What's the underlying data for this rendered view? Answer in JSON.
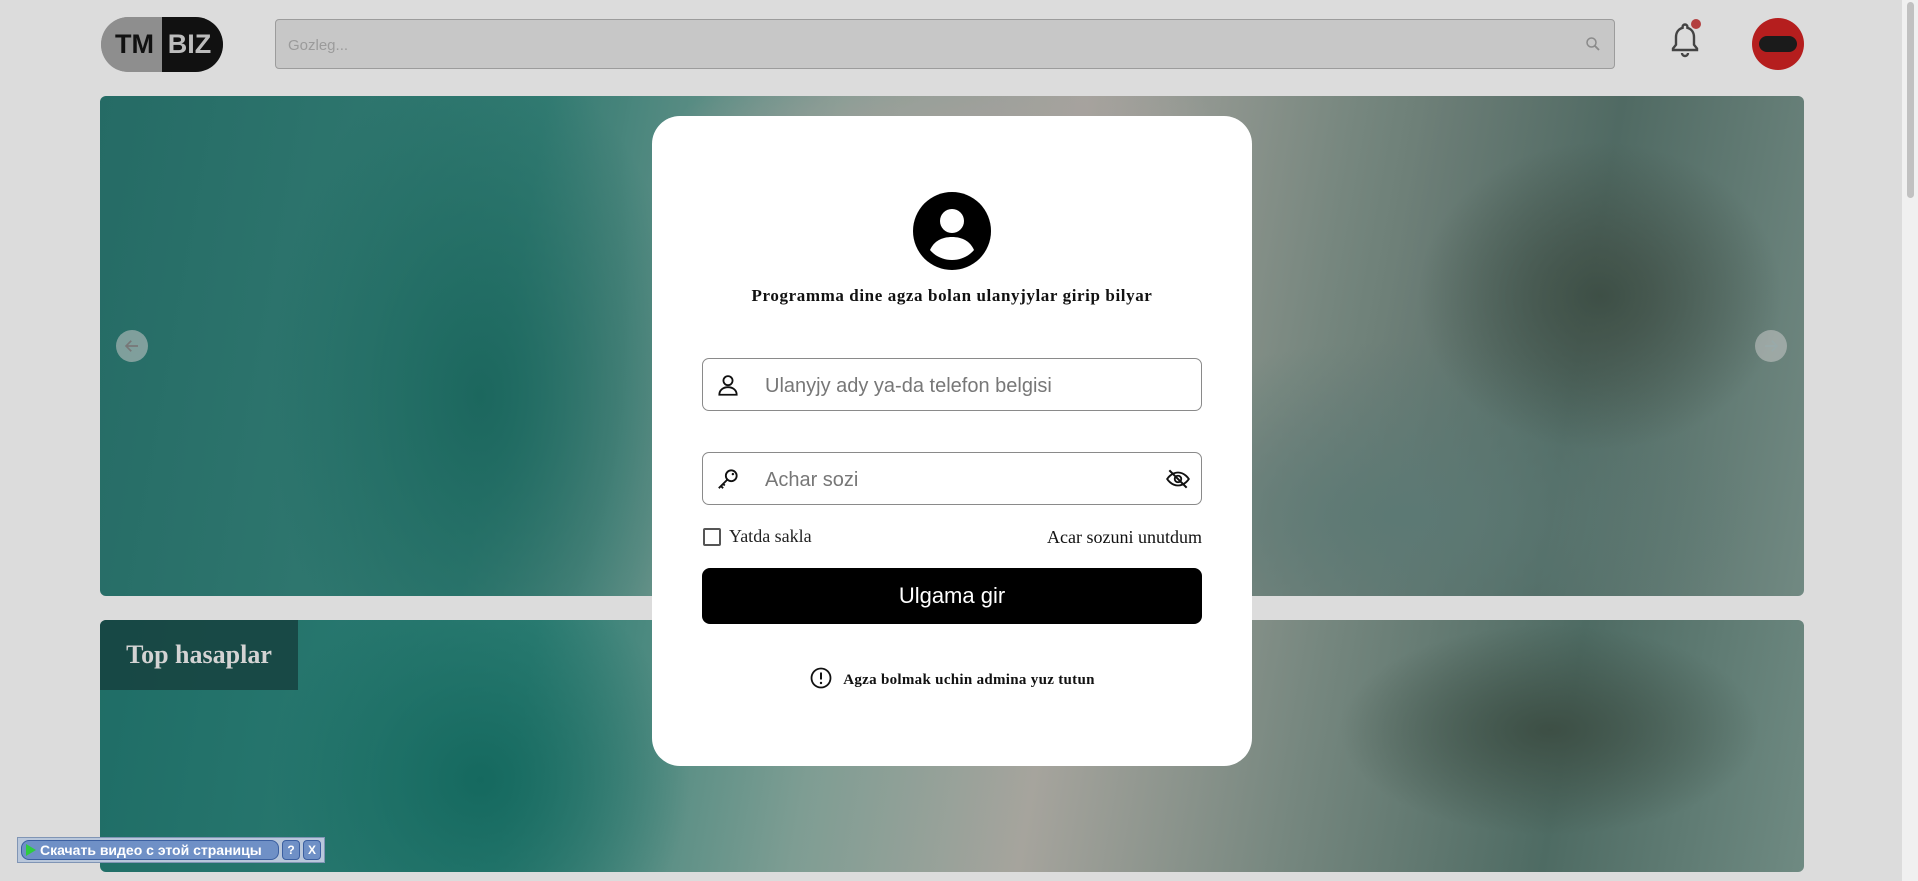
{
  "header": {
    "logo_left": "TM",
    "logo_right": "BIZ",
    "search_placeholder": "Gozleg...",
    "icons": [
      "search-icon",
      "bell-icon",
      "avatar"
    ]
  },
  "banner": {
    "dots_count": 4,
    "active_dot": 0
  },
  "section": {
    "title": "Top hasaplar"
  },
  "login": {
    "title": "Programma dine agza bolan ulanyjylar girip bilyar",
    "username_placeholder": "Ulanyjy ady ya-da telefon belgisi",
    "password_placeholder": "Achar sozi",
    "remember_label": "Yatda sakla",
    "forgot_label": "Acar sozuni unutdum",
    "submit_label": "Ulgama gir",
    "note": "Agza bolmak uchin admina yuz tutun"
  },
  "download_bar": {
    "label": "Скачать видео с этой страницы",
    "help": "?",
    "close": "X"
  },
  "colors": {
    "button_bg": "#000000",
    "notification_dot": "#b34040",
    "active_dot": "#1a8f45"
  }
}
